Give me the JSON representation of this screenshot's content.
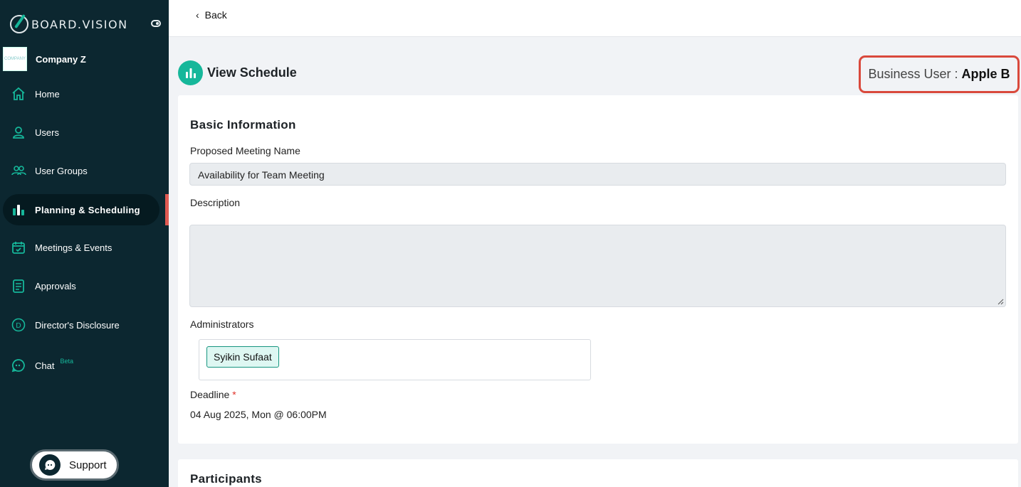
{
  "app": {
    "brand": "BOARD.VISION",
    "company": "Company Z",
    "company_logo_text": "COMPANY"
  },
  "sidebar": {
    "items": [
      {
        "label": "Home",
        "icon": "home-icon"
      },
      {
        "label": "Users",
        "icon": "user-icon"
      },
      {
        "label": "User Groups",
        "icon": "user-group-icon"
      },
      {
        "label": "Planning & Scheduling",
        "icon": "bar-chart-icon",
        "active": true
      },
      {
        "label": "Meetings & Events",
        "icon": "calendar-check-icon"
      },
      {
        "label": "Approvals",
        "icon": "document-icon"
      },
      {
        "label": "Director's Disclosure",
        "icon": "d-circle-icon"
      },
      {
        "label": "Chat",
        "icon": "chat-icon",
        "badge": "Beta"
      }
    ],
    "support_label": "Support"
  },
  "topbar": {
    "back_label": "Back"
  },
  "header": {
    "title": "View Schedule",
    "business_user_prefix": "Business User :",
    "business_user_name": "Apple B"
  },
  "basic_info": {
    "section_title": "Basic Information",
    "meeting_name_label": "Proposed Meeting Name",
    "meeting_name_value": "Availability for Team Meeting",
    "description_label": "Description",
    "description_value": "",
    "administrators_label": "Administrators",
    "administrators": [
      "Syikin Sufaat"
    ],
    "deadline_label": "Deadline",
    "deadline_required_mark": "*",
    "deadline_value": "04 Aug 2025, Mon @ 06:00PM"
  },
  "participants": {
    "section_title": "Participants"
  },
  "colors": {
    "sidebar_bg": "#0c2730",
    "accent": "#16b79a",
    "highlight_border": "#d9493c",
    "active_bar": "#e05a52"
  }
}
